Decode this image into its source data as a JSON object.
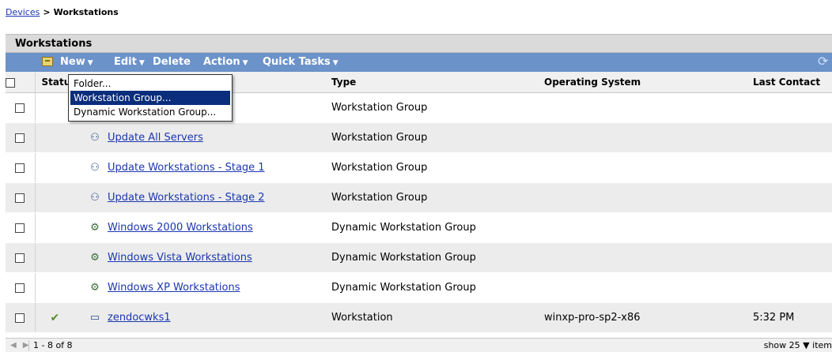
{
  "breadcrumb": {
    "parent": "Devices",
    "separator": ">",
    "current": "Workstations"
  },
  "panel_title": "Workstations",
  "toolbar": {
    "new": "New",
    "edit": "Edit",
    "delete": "Delete",
    "action": "Action",
    "quick_tasks": "Quick Tasks",
    "refresh_icon": "refresh-icon"
  },
  "columns": {
    "status": "Statu",
    "type": "Type",
    "os": "Operating System",
    "last_contact": "Last Contact"
  },
  "dropdown": [
    "Folder...",
    "Workstation Group...",
    "Dynamic Workstation Group..."
  ],
  "rows": [
    {
      "name": "",
      "type": "Workstation Group",
      "os": "",
      "last_contact": "",
      "icon": "group-icon"
    },
    {
      "name": "Update All Servers",
      "type": "Workstation Group",
      "os": "",
      "last_contact": "",
      "icon": "group-icon"
    },
    {
      "name": "Update Workstations - Stage 1",
      "type": "Workstation Group",
      "os": "",
      "last_contact": "",
      "icon": "group-icon"
    },
    {
      "name": "Update Workstations - Stage 2",
      "type": "Workstation Group",
      "os": "",
      "last_contact": "",
      "icon": "group-icon"
    },
    {
      "name": "Windows 2000 Workstations",
      "type": "Dynamic Workstation Group",
      "os": "",
      "last_contact": "",
      "icon": "dynamic-group-icon"
    },
    {
      "name": "Windows Vista Workstations",
      "type": "Dynamic Workstation Group",
      "os": "",
      "last_contact": "",
      "icon": "dynamic-group-icon"
    },
    {
      "name": "Windows XP Workstations",
      "type": "Dynamic Workstation Group",
      "os": "",
      "last_contact": "",
      "icon": "dynamic-group-icon"
    },
    {
      "name": "zendocwks1",
      "type": "Workstation",
      "os": "winxp-pro-sp2-x86",
      "last_contact": "5:32 PM",
      "icon": "workstation-icon",
      "status_icon": "status-ok-icon"
    }
  ],
  "footer": {
    "range": "1 - 8 of 8",
    "show_label": "show",
    "page_size": "25",
    "items_label": "item"
  }
}
